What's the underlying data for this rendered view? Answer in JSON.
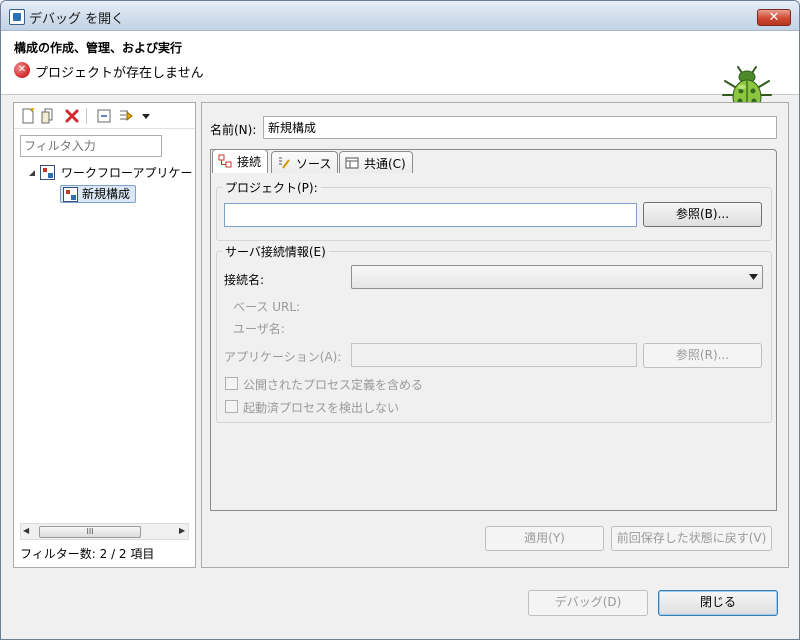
{
  "window": {
    "title": "デバッグ を開く",
    "close_label": "✕"
  },
  "header": {
    "title": "構成の作成、管理、および実行",
    "message": "プロジェクトが存在しません"
  },
  "left": {
    "filter_placeholder": "フィルタ入力",
    "tree": [
      {
        "label": "ワークフローアプリケー",
        "expanded": true
      },
      {
        "label": "新規構成",
        "selected": true
      }
    ],
    "scroll_grip": "III",
    "filter_count": "フィルター数: 2 / 2 項目"
  },
  "right": {
    "name_label": "名前(N):",
    "name_value": "新規構成",
    "tabs": [
      {
        "label": "接続",
        "icon": "connection-icon",
        "active": true
      },
      {
        "label": "ソース",
        "icon": "source-icon"
      },
      {
        "label": "共通(C)",
        "icon": "common-icon"
      }
    ],
    "project_group": "プロジェクト(P):",
    "project_value": "",
    "browse_label": "参照(B)...",
    "server_group": "サーバ接続情報(E)",
    "connection_label": "接続名:",
    "connection_value": "",
    "base_url_label": "ベース URL:",
    "user_label": "ユーザ名:",
    "app_label": "アプリケーション(A):",
    "app_value": "",
    "browse_r_label": "参照(R)...",
    "checkbox1": "公開されたプロセス定義を含める",
    "checkbox2": "起動済プロセスを検出しない",
    "apply_label": "適用(Y)",
    "revert_label": "前回保存した状態に戻す(V)"
  },
  "footer": {
    "debug_label": "デバッグ(D)",
    "close_label": "閉じる"
  },
  "colors": {
    "title_bar": "#c3d3e6",
    "error": "#d12a2a",
    "close_button": "#cf4a32"
  }
}
